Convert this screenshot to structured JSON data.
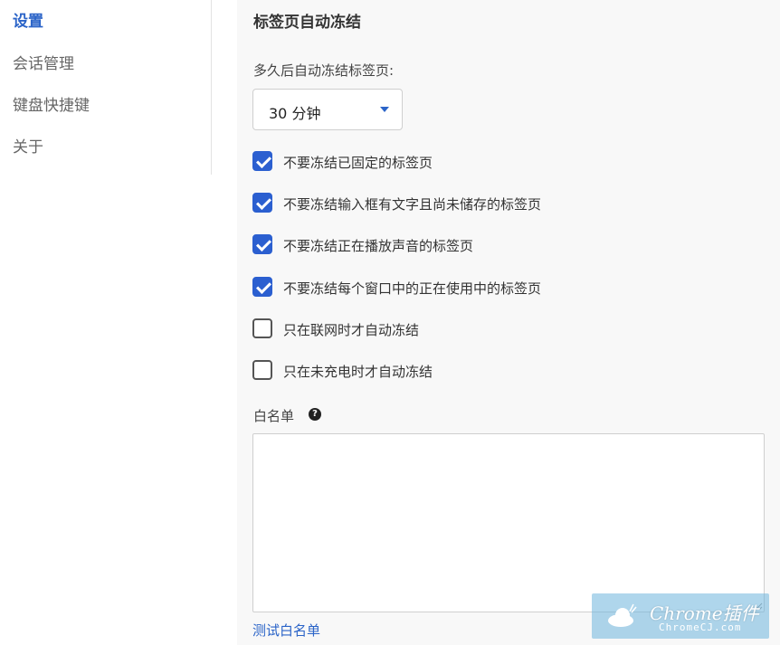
{
  "sidebar": {
    "items": [
      {
        "label": "设置",
        "active": true
      },
      {
        "label": "会话管理",
        "active": false
      },
      {
        "label": "键盘快捷键",
        "active": false
      },
      {
        "label": "关于",
        "active": false
      }
    ]
  },
  "main": {
    "section_title": "标签页自动冻结",
    "delay_label": "多久后自动冻结标签页:",
    "delay_select": {
      "value": "30 分钟"
    },
    "options": [
      {
        "label": "不要冻结已固定的标签页",
        "checked": true
      },
      {
        "label": "不要冻结输入框有文字且尚未储存的标签页",
        "checked": true
      },
      {
        "label": "不要冻结正在播放声音的标签页",
        "checked": true
      },
      {
        "label": "不要冻结每个窗口中的正在使用中的标签页",
        "checked": true
      },
      {
        "label": "只在联网时才自动冻结",
        "checked": false
      },
      {
        "label": "只在未充电时才自动冻结",
        "checked": false
      }
    ],
    "whitelist_label": "白名单",
    "help_icon": "?",
    "whitelist_value": "",
    "test_whitelist_link": "测试白名单"
  },
  "watermark": {
    "title": "Chrome插件",
    "subtitle": "ChromeCJ.com"
  },
  "colors": {
    "accent": "#2b64c8",
    "checkbox_checked": "#2b5fd0",
    "watermark_bg": "#6eb4dc"
  }
}
